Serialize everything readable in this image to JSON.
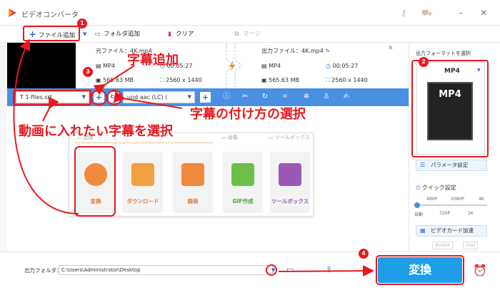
{
  "app": {
    "title": "ビデオコンバータ"
  },
  "toolbar": {
    "add_file": "ファイル追加",
    "add_folder": "フォルダ追加",
    "clear": "クリア",
    "merge": "マージ"
  },
  "file": {
    "source_label": "元ファイル：",
    "source_name": "4K.mp4",
    "output_label": "出力ファイル：",
    "output_name": "4K.mp4",
    "src_format": "MP4",
    "src_duration": "00:05:27",
    "src_size": "565.63 MB",
    "src_res": "2560 x 1440",
    "out_format": "MP4",
    "out_duration": "00:05:27",
    "out_size": "565.63 MB",
    "out_res": "2560 x 1440"
  },
  "subtitle_select": {
    "value": "1-files.srt"
  },
  "audio_select": {
    "value": "und aac (LC) ("
  },
  "panel": {
    "tab_video": "動画",
    "tab_image": "画像",
    "tab_toolbox": "ツールボックス",
    "cards": [
      {
        "label": "変換"
      },
      {
        "label": "ダウンロード"
      },
      {
        "label": "録画"
      },
      {
        "label": "GIF作成"
      },
      {
        "label": "ツールボックス"
      }
    ]
  },
  "side": {
    "format_title": "出力フォーマットを選択",
    "format_value": "MP4",
    "param_button": "パラメータ設定",
    "quick_title": "クイック設定",
    "quality_top": [
      "480P",
      "1080P",
      "4K"
    ],
    "quality_bottom": [
      "自動",
      "720P",
      "2K"
    ],
    "gpu_button": "ビデオカード加速",
    "gpu_tags": [
      "NVIDIA",
      "Intel"
    ]
  },
  "bottom": {
    "folder_label": "出力フォルダ：",
    "folder_path": "C:\\Users\\Administrator\\Desktop",
    "convert_button": "変換"
  },
  "annotations": {
    "n1": "1",
    "n2": "2",
    "n3": "3",
    "n4": "4",
    "subtitle_add": "字幕追加",
    "subtitle_method": "字幕の付け方の選択",
    "subtitle_select": "動画に入れたい字幕を選択"
  },
  "colors": {
    "accent": "#4a90e2",
    "convert": "#1e9ee8",
    "annotation": "#e8191f",
    "card_text": "#e07a3c"
  }
}
